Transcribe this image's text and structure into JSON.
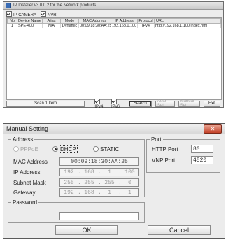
{
  "installer": {
    "title": "IP Installer v3.0.0.2 for the Network products",
    "options": [
      {
        "label": "IP CAMERA",
        "checked": true
      },
      {
        "label": "NVR",
        "checked": true
      }
    ],
    "columns": [
      "No",
      "Device Name",
      "Alias",
      "Mode",
      "MAC Address",
      "IP Address",
      "Protocol",
      "URL"
    ],
    "rows": [
      [
        "1",
        "SPE-400",
        "N/A",
        "Dynamic",
        "00:09:18:30:AA:25",
        "192.168.1.100",
        "IPv4",
        "http://192.168.1.100/index.htm"
      ]
    ],
    "status": "Scan 1 Item",
    "ipv4_label": "IPv4",
    "ipv6_label": "IPv6",
    "ipv4_checked": true,
    "ipv6_checked": true,
    "buttons": {
      "search": "Search",
      "auto_set": "Auto Set",
      "manual_set": "Manual Set",
      "exit": "Exit"
    }
  },
  "manual": {
    "title": "Manual Setting",
    "close_glyph": "✕",
    "address_legend": "Address",
    "mode_options": [
      {
        "label": "PPPoE",
        "selected": false,
        "enabled": false
      },
      {
        "label": "DHCP",
        "selected": true,
        "enabled": true
      },
      {
        "label": "STATIC",
        "selected": false,
        "enabled": true
      }
    ],
    "mac_label": "MAC Address",
    "mac_value": "00:09:18:30:AA:25",
    "ip_label": "IP Address",
    "ip_value": [
      "192",
      "168",
      "1",
      "100"
    ],
    "subnet_label": "Subnet Mask",
    "subnet_value": [
      "255",
      "255",
      "255",
      "0"
    ],
    "gateway_label": "Gateway",
    "gateway_value": [
      "192",
      "168",
      "1",
      "1"
    ],
    "port_legend": "Port",
    "http_label": "HTTP Port",
    "http_value": "80",
    "vnp_label": "VNP Port",
    "vnp_value": "4520",
    "password_legend": "Password",
    "password_value": "",
    "ok_label": "OK",
    "cancel_label": "Cancel"
  }
}
